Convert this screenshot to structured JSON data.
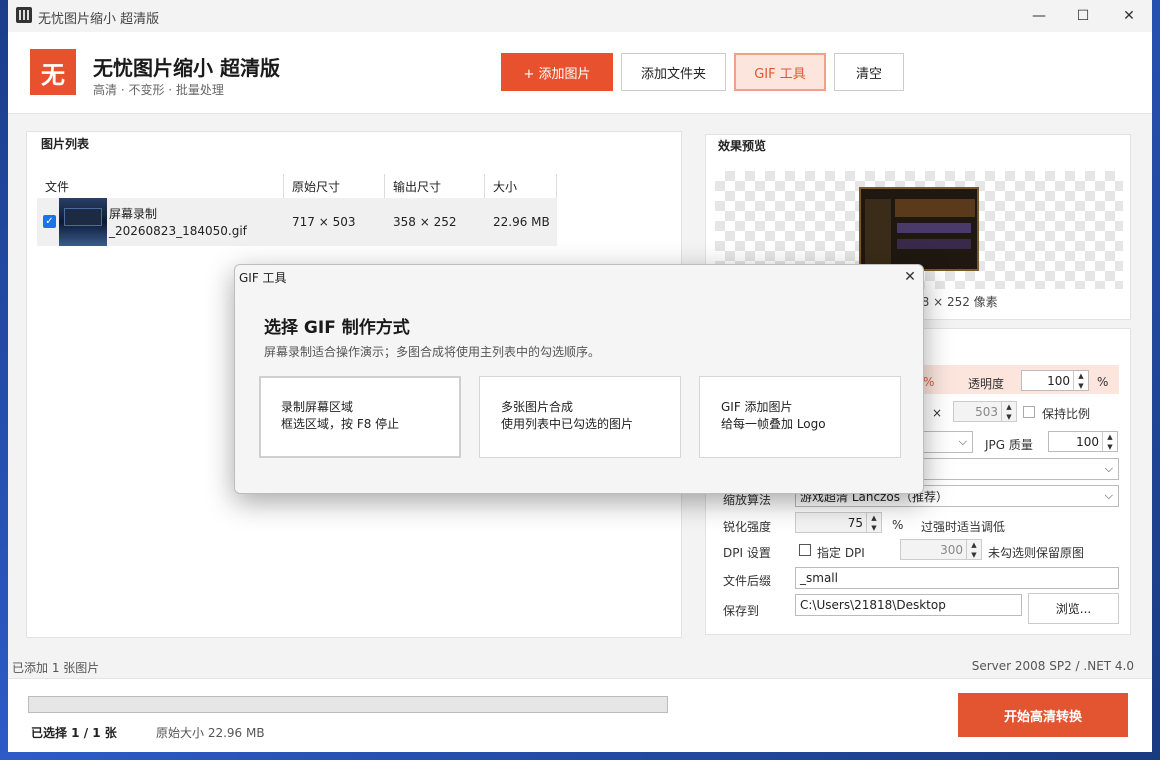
{
  "window": {
    "title": "无忧图片缩小 超清版"
  },
  "icons": {
    "app": "app-icon",
    "minimize": "minimize-icon",
    "maximize": "maximize-icon",
    "close": "close-icon",
    "dialog_close": "close-icon",
    "check": "checkmark-icon",
    "spin": "spin-arrows-icon",
    "dropdown": "chevron-down-icon"
  },
  "colors": {
    "accent": "#e8512e",
    "primary_button": "#e25530",
    "gif_button_bg": "#fbe5dd",
    "checkbox_checked": "#1a73e8"
  },
  "header": {
    "logo_char": "无",
    "title": "无忧图片缩小 超清版",
    "subtitle": "高清 · 不变形 · 批量处理",
    "buttons": {
      "add_image": "+  添加图片",
      "add_folder": "添加文件夹",
      "gif_tool": "GIF 工具",
      "clear": "清空"
    }
  },
  "image_list": {
    "legend": "图片列表",
    "columns": [
      "文件",
      "原始尺寸",
      "输出尺寸",
      "大小"
    ],
    "rows": [
      {
        "checked": true,
        "file_line1": "屏幕录制",
        "file_line2": "_20260823_184050.gif",
        "original": "717 × 503",
        "output": "358 × 252",
        "size": "22.96 MB"
      }
    ]
  },
  "preview": {
    "legend": "效果预览",
    "caption_partial": "58 × 252 像素"
  },
  "settings": {
    "partial_percent": "%",
    "opacity_label": "透明度",
    "opacity_value": "100",
    "opacity_unit": "%",
    "times": "×",
    "height_value": "503",
    "keep_ratio_label": "保持比例",
    "jpg_quality_label": "JPG 质量",
    "jpg_quality_value": "100",
    "scale_algo_label": "缩放算法",
    "scale_algo_value": "游戏超清 Lanczos（推荐）",
    "sharpen_label": "锐化强度",
    "sharpen_value": "75",
    "sharpen_unit": "%",
    "sharpen_hint": "过强时适当调低",
    "dpi_label": "DPI 设置",
    "dpi_check_label": "指定 DPI",
    "dpi_value": "300",
    "dpi_hint": "未勾选则保留原图",
    "suffix_label": "文件后缀",
    "suffix_value": "_small",
    "save_label": "保存到",
    "save_path": "C:\\Users\\21818\\Desktop",
    "browse": "浏览..."
  },
  "status": {
    "left": "已添加 1 张图片",
    "right": "Server 2008 SP2 / .NET 4.0"
  },
  "footer": {
    "selected": "已选择 1 / 1 张",
    "original_size": "原始大小 22.96 MB",
    "progress": 0,
    "start": "开始高清转换"
  },
  "dialog": {
    "title": "GIF 工具",
    "heading": "选择 GIF 制作方式",
    "description": "屏幕录制适合操作演示；多图合成将使用主列表中的勾选顺序。",
    "options": [
      {
        "title": "录制屏幕区域",
        "desc": "框选区域，按 F8 停止"
      },
      {
        "title": "多张图片合成",
        "desc": "使用列表中已勾选的图片"
      },
      {
        "title": "GIF 添加图片",
        "desc": "给每一帧叠加 Logo"
      }
    ]
  }
}
